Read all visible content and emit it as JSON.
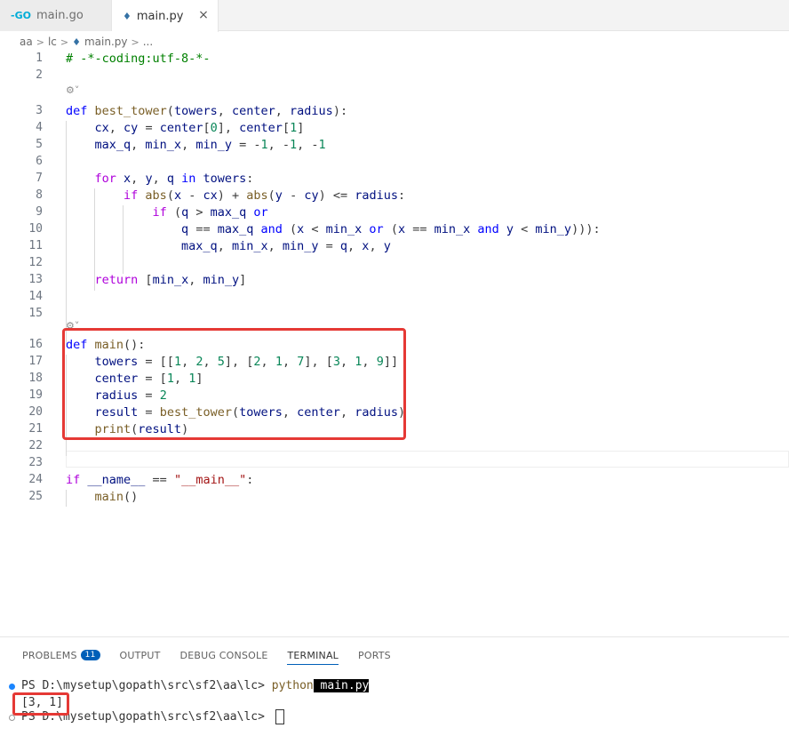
{
  "tabs": [
    {
      "label": "main.go",
      "icon": "go-icon"
    },
    {
      "label": "main.py",
      "icon": "python-icon"
    }
  ],
  "tab_close_glyph": "×",
  "breadcrumb": {
    "parts": [
      "aa",
      "lc",
      "main.py",
      "..."
    ]
  },
  "editor": {
    "lines": [
      {
        "n": "1",
        "tokens": [
          [
            "cmt",
            "# -*-coding:utf-8-*-"
          ]
        ]
      },
      {
        "n": "2",
        "tokens": []
      },
      {
        "n": "3",
        "tokens": [
          [
            "kw",
            "def "
          ],
          [
            "fn",
            "best_tower"
          ],
          [
            "op",
            "("
          ],
          [
            "var",
            "towers"
          ],
          [
            "op",
            ", "
          ],
          [
            "var",
            "center"
          ],
          [
            "op",
            ", "
          ],
          [
            "var",
            "radius"
          ],
          [
            "op",
            "):"
          ]
        ]
      },
      {
        "n": "4",
        "tokens": [
          [
            "op",
            "    "
          ],
          [
            "var",
            "cx"
          ],
          [
            "op",
            ", "
          ],
          [
            "var",
            "cy"
          ],
          [
            "op",
            " = "
          ],
          [
            "var",
            "center"
          ],
          [
            "op",
            "["
          ],
          [
            "num",
            "0"
          ],
          [
            "op",
            "], "
          ],
          [
            "var",
            "center"
          ],
          [
            "op",
            "["
          ],
          [
            "num",
            "1"
          ],
          [
            "op",
            "]"
          ]
        ]
      },
      {
        "n": "5",
        "tokens": [
          [
            "op",
            "    "
          ],
          [
            "var",
            "max_q"
          ],
          [
            "op",
            ", "
          ],
          [
            "var",
            "min_x"
          ],
          [
            "op",
            ", "
          ],
          [
            "var",
            "min_y"
          ],
          [
            "op",
            " = -"
          ],
          [
            "num",
            "1"
          ],
          [
            "op",
            ", -"
          ],
          [
            "num",
            "1"
          ],
          [
            "op",
            ", -"
          ],
          [
            "num",
            "1"
          ]
        ]
      },
      {
        "n": "6",
        "tokens": []
      },
      {
        "n": "7",
        "tokens": [
          [
            "op",
            "    "
          ],
          [
            "kw2",
            "for "
          ],
          [
            "var",
            "x"
          ],
          [
            "op",
            ", "
          ],
          [
            "var",
            "y"
          ],
          [
            "op",
            ", "
          ],
          [
            "var",
            "q"
          ],
          [
            "kw",
            " in "
          ],
          [
            "var",
            "towers"
          ],
          [
            "op",
            ":"
          ]
        ]
      },
      {
        "n": "8",
        "tokens": [
          [
            "op",
            "        "
          ],
          [
            "kw2",
            "if "
          ],
          [
            "fn",
            "abs"
          ],
          [
            "op",
            "("
          ],
          [
            "var",
            "x"
          ],
          [
            "op",
            " - "
          ],
          [
            "var",
            "cx"
          ],
          [
            "op",
            ") + "
          ],
          [
            "fn",
            "abs"
          ],
          [
            "op",
            "("
          ],
          [
            "var",
            "y"
          ],
          [
            "op",
            " - "
          ],
          [
            "var",
            "cy"
          ],
          [
            "op",
            ") <= "
          ],
          [
            "var",
            "radius"
          ],
          [
            "op",
            ":"
          ]
        ]
      },
      {
        "n": "9",
        "tokens": [
          [
            "op",
            "            "
          ],
          [
            "kw2",
            "if "
          ],
          [
            "op",
            "("
          ],
          [
            "var",
            "q"
          ],
          [
            "op",
            " > "
          ],
          [
            "var",
            "max_q"
          ],
          [
            "kw",
            " or"
          ]
        ]
      },
      {
        "n": "10",
        "tokens": [
          [
            "op",
            "                "
          ],
          [
            "var",
            "q"
          ],
          [
            "op",
            " == "
          ],
          [
            "var",
            "max_q"
          ],
          [
            "kw",
            " and "
          ],
          [
            "op",
            "("
          ],
          [
            "var",
            "x"
          ],
          [
            "op",
            " < "
          ],
          [
            "var",
            "min_x"
          ],
          [
            "kw",
            " or "
          ],
          [
            "op",
            "("
          ],
          [
            "var",
            "x"
          ],
          [
            "op",
            " == "
          ],
          [
            "var",
            "min_x"
          ],
          [
            "kw",
            " and "
          ],
          [
            "var",
            "y"
          ],
          [
            "op",
            " < "
          ],
          [
            "var",
            "min_y"
          ],
          [
            "op",
            ")))"
          ],
          [
            "op",
            ":"
          ]
        ]
      },
      {
        "n": "11",
        "tokens": [
          [
            "op",
            "                "
          ],
          [
            "var",
            "max_q"
          ],
          [
            "op",
            ", "
          ],
          [
            "var",
            "min_x"
          ],
          [
            "op",
            ", "
          ],
          [
            "var",
            "min_y"
          ],
          [
            "op",
            " = "
          ],
          [
            "var",
            "q"
          ],
          [
            "op",
            ", "
          ],
          [
            "var",
            "x"
          ],
          [
            "op",
            ", "
          ],
          [
            "var",
            "y"
          ]
        ]
      },
      {
        "n": "12",
        "tokens": []
      },
      {
        "n": "13",
        "tokens": [
          [
            "op",
            "    "
          ],
          [
            "kw2",
            "return "
          ],
          [
            "op",
            "["
          ],
          [
            "var",
            "min_x"
          ],
          [
            "op",
            ", "
          ],
          [
            "var",
            "min_y"
          ],
          [
            "op",
            "]"
          ]
        ]
      },
      {
        "n": "14",
        "tokens": []
      },
      {
        "n": "15",
        "tokens": []
      },
      {
        "n": "16",
        "tokens": [
          [
            "kw",
            "def "
          ],
          [
            "fn",
            "main"
          ],
          [
            "op",
            "():"
          ]
        ]
      },
      {
        "n": "17",
        "tokens": [
          [
            "op",
            "    "
          ],
          [
            "var",
            "towers"
          ],
          [
            "op",
            " = [["
          ],
          [
            "num",
            "1"
          ],
          [
            "op",
            ", "
          ],
          [
            "num",
            "2"
          ],
          [
            "op",
            ", "
          ],
          [
            "num",
            "5"
          ],
          [
            "op",
            "], ["
          ],
          [
            "num",
            "2"
          ],
          [
            "op",
            ", "
          ],
          [
            "num",
            "1"
          ],
          [
            "op",
            ", "
          ],
          [
            "num",
            "7"
          ],
          [
            "op",
            "], ["
          ],
          [
            "num",
            "3"
          ],
          [
            "op",
            ", "
          ],
          [
            "num",
            "1"
          ],
          [
            "op",
            ", "
          ],
          [
            "num",
            "9"
          ],
          [
            "op",
            "]]"
          ]
        ]
      },
      {
        "n": "18",
        "tokens": [
          [
            "op",
            "    "
          ],
          [
            "var",
            "center"
          ],
          [
            "op",
            " = ["
          ],
          [
            "num",
            "1"
          ],
          [
            "op",
            ", "
          ],
          [
            "num",
            "1"
          ],
          [
            "op",
            "]"
          ]
        ]
      },
      {
        "n": "19",
        "tokens": [
          [
            "op",
            "    "
          ],
          [
            "var",
            "radius"
          ],
          [
            "op",
            " = "
          ],
          [
            "num",
            "2"
          ]
        ]
      },
      {
        "n": "20",
        "tokens": [
          [
            "op",
            "    "
          ],
          [
            "var",
            "result"
          ],
          [
            "op",
            " = "
          ],
          [
            "fn",
            "best_tower"
          ],
          [
            "op",
            "("
          ],
          [
            "var",
            "towers"
          ],
          [
            "op",
            ", "
          ],
          [
            "var",
            "center"
          ],
          [
            "op",
            ", "
          ],
          [
            "var",
            "radius"
          ],
          [
            "op",
            ")"
          ]
        ]
      },
      {
        "n": "21",
        "tokens": [
          [
            "op",
            "    "
          ],
          [
            "fn",
            "print"
          ],
          [
            "op",
            "("
          ],
          [
            "var",
            "result"
          ],
          [
            "op",
            ")"
          ]
        ]
      },
      {
        "n": "22",
        "tokens": []
      },
      {
        "n": "23",
        "tokens": []
      },
      {
        "n": "24",
        "tokens": [
          [
            "kw2",
            "if "
          ],
          [
            "var",
            "__name__"
          ],
          [
            "op",
            " == "
          ],
          [
            "str",
            "\"__main__\""
          ],
          [
            "op",
            ":"
          ]
        ]
      },
      {
        "n": "25",
        "tokens": [
          [
            "op",
            "    "
          ],
          [
            "fn",
            "main"
          ],
          [
            "op",
            "()"
          ]
        ]
      }
    ],
    "codelens_glyph": "⚙˅"
  },
  "panel": {
    "tabs": [
      {
        "label": "PROBLEMS",
        "badge": "11"
      },
      {
        "label": "OUTPUT"
      },
      {
        "label": "DEBUG CONSOLE"
      },
      {
        "label": "TERMINAL",
        "active": true
      },
      {
        "label": "PORTS"
      }
    ],
    "terminal": {
      "line1_prompt": "PS D:\\mysetup\\gopath\\src\\sf2\\aa\\lc> ",
      "line1_cmd": "python",
      "line1_arg": " main.py",
      "line2_output": "[3, 1]",
      "line3_prompt": "PS D:\\mysetup\\gopath\\src\\sf2\\aa\\lc> "
    }
  },
  "colors": {
    "accent": "#005fb8",
    "highlight": "#e53935"
  }
}
